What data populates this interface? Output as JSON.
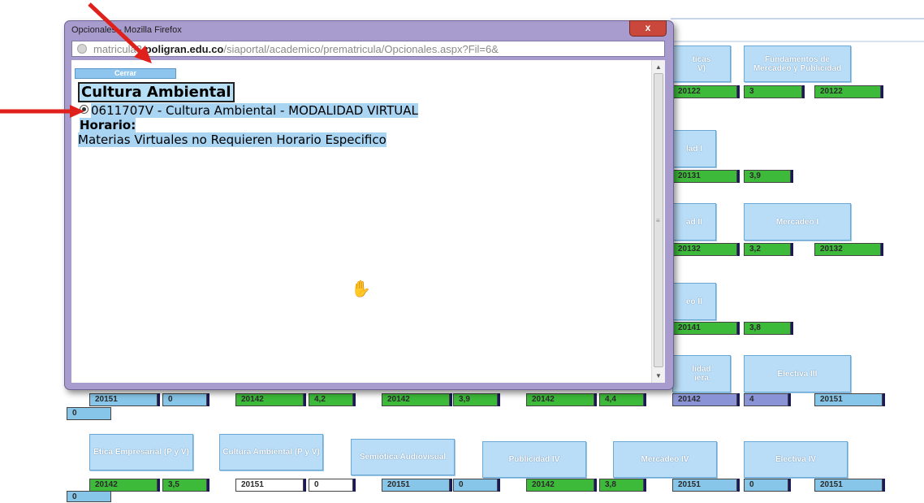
{
  "window": {
    "title": "Opcionales - Mozilla Firefox",
    "close_glyph": "x",
    "url_prefix": "matricula3.",
    "url_domain": "poligran.edu.co",
    "url_path": "/siaportal/academico/prematricula/Opcionales.aspx?Fil=6&"
  },
  "popup": {
    "close_button": "Cerrar",
    "course_title": "Cultura Ambiental",
    "option_label": "0611707V - Cultura Ambiental - MODALIDAD VIRTUAL",
    "schedule_label": "Horario:",
    "schedule_text": "Materias Virtuales no Requieren Horario Especifico"
  },
  "background": {
    "top_right_buttons": [
      {
        "label": "ticas\nV)"
      },
      {
        "label": "Fundamentos de Mercadeo y Publicidad"
      }
    ],
    "row1_cells": [
      "20122",
      "3",
      "20122"
    ],
    "mid_labels": [
      "lad I",
      "ad II",
      "Mercadeo I",
      "eo II",
      "lidad\niera",
      "Electiva III"
    ],
    "row2_cells": [
      "20131",
      "3,9"
    ],
    "row3_cells": [
      "20132",
      "3,2",
      "20132"
    ],
    "row4_cells": [
      "20141",
      "3,8"
    ],
    "row5_cells": [
      "20151",
      "0",
      "20142",
      "4,2",
      "20142",
      "3,9",
      "20142",
      "4,4",
      "20142",
      "4",
      "20151",
      "0"
    ],
    "bottom_buttons": [
      "Etica Empresarial (P y V)",
      "Cultura Ambiental (P y V)",
      "Semiótica Audiovisual",
      "Publicidad IV",
      "Mercadeo IV",
      "Electiva IV"
    ],
    "row6_cells": [
      "20142",
      "3,5",
      "20151",
      "0",
      "20151",
      "0",
      "20142",
      "3,8",
      "20151",
      "0",
      "20151",
      "0"
    ]
  },
  "colors": {
    "annotation_arrow": "#e0201b",
    "window_frame": "#a79ccd",
    "selection": "#a9d4f2"
  }
}
